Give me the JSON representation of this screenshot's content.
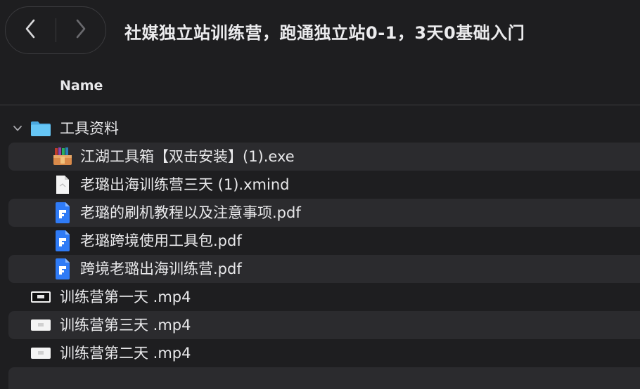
{
  "window": {
    "title": "社媒独立站训练营，跑通独立站0-1，3天0基础入门"
  },
  "column_header": {
    "name": "Name"
  },
  "files": [
    {
      "name": "工具资料",
      "kind": "folder",
      "level": 0,
      "expanded": true,
      "icon": "folder-icon"
    },
    {
      "name": "江湖工具箱【双击安装】(1).exe",
      "kind": "exe",
      "level": 1,
      "icon": "archive-installer-icon"
    },
    {
      "name": "老璐出海训练营三天 (1).xmind",
      "kind": "xmind",
      "level": 1,
      "icon": "document-icon"
    },
    {
      "name": "老璐的刷机教程以及注意事项.pdf",
      "kind": "pdf",
      "level": 1,
      "icon": "pdf-icon"
    },
    {
      "name": "老璐跨境使用工具包.pdf",
      "kind": "pdf",
      "level": 1,
      "icon": "pdf-icon"
    },
    {
      "name": "跨境老璐出海训练营.pdf",
      "kind": "pdf",
      "level": 1,
      "icon": "pdf-icon"
    },
    {
      "name": "训练营第一天 .mp4",
      "kind": "mp4",
      "level": 0,
      "icon": "video-icon"
    },
    {
      "name": "训练营第三天 .mp4",
      "kind": "mp4",
      "level": 0,
      "icon": "video-icon"
    },
    {
      "name": "训练营第二天 .mp4",
      "kind": "mp4",
      "level": 0,
      "icon": "video-icon"
    }
  ],
  "colors": {
    "background": "#1e1e20",
    "row_stripe": "#2b2b2e",
    "folder_blue": "#5fc3f4",
    "pdf_blue": "#2f7bf6"
  }
}
